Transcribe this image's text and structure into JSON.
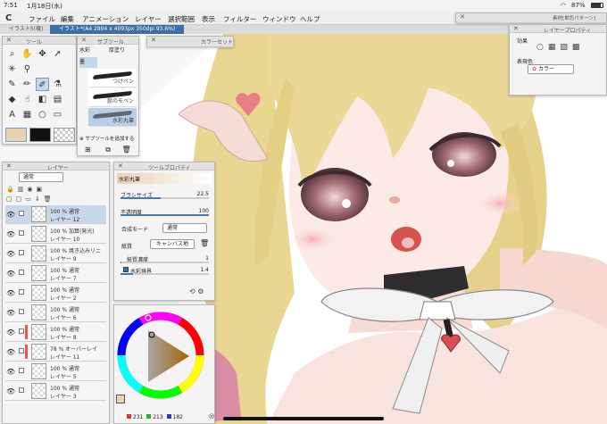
{
  "status": {
    "time": "7:51",
    "date": "1月18日(水)",
    "battery": "87%"
  },
  "menu": {
    "logo": "C",
    "items": [
      "ファイル",
      "編集",
      "アニメーション",
      "レイヤー",
      "選択範囲",
      "表示",
      "フィルター",
      "ウィンドウ",
      "ヘルプ"
    ]
  },
  "tabs": [
    {
      "label": "イラスト5(複)"
    },
    {
      "label": "イラスト*(A4 2894 x 4093px 350dpi 93.6%)"
    }
  ],
  "tool_panel": {
    "title": "ツール"
  },
  "subtool_panel": {
    "title": "サブツール",
    "tabs": [
      "水彩",
      "厚塗り"
    ],
    "group": "墨",
    "brushes": [
      "つけペン",
      "髭のモペン",
      "水彩丸筆"
    ],
    "add_label": "サブツールを追加する"
  },
  "color_set_panel": {
    "title": "カラーセット"
  },
  "layer_panel": {
    "title": "レイヤー",
    "blend_mode": "通常",
    "layers": [
      {
        "mode": "100 % 通常",
        "name": "レイヤー 12",
        "selected": true,
        "bar": "",
        "visible": true
      },
      {
        "mode": "100 % 加算(発光)",
        "name": "レイヤー 10",
        "selected": false,
        "bar": "",
        "visible": true
      },
      {
        "mode": "100 % 焼き込みリニ",
        "name": "レイヤー 9",
        "selected": false,
        "bar": "",
        "visible": true
      },
      {
        "mode": "100 % 通常",
        "name": "レイヤー 7",
        "selected": false,
        "bar": "",
        "visible": true
      },
      {
        "mode": "100 % 通常",
        "name": "レイヤー 2",
        "selected": false,
        "bar": "",
        "visible": true
      },
      {
        "mode": "100 % 通常",
        "name": "レイヤー 6",
        "selected": false,
        "bar": "",
        "visible": true
      },
      {
        "mode": "100 % 通常",
        "name": "レイヤー 8",
        "selected": false,
        "bar": "#e35a5a",
        "visible": true
      },
      {
        "mode": "78 % オーバーレイ",
        "name": "レイヤー 11",
        "selected": false,
        "bar": "#e35a5a",
        "visible": true
      },
      {
        "mode": "100 % 通常",
        "name": "レイヤー 5",
        "selected": false,
        "bar": "",
        "visible": true
      },
      {
        "mode": "100 % 通常",
        "name": "レイヤー 3",
        "selected": false,
        "bar": "",
        "visible": true
      }
    ]
  },
  "tool_property": {
    "title": "ツールプロパティ",
    "brush_name": "水彩丸筆",
    "brush_size": {
      "label": "ブラシサイズ",
      "value": "22.5",
      "fraction": 0.45
    },
    "opacity": {
      "label": "不透明度",
      "value": "100",
      "fraction": 1.0
    },
    "blend": {
      "label": "合成モード",
      "value": "通常"
    },
    "paper": {
      "label": "紙質",
      "value": "キャンバス地"
    },
    "paper_density": {
      "label": "紙質濃度",
      "value": "1",
      "fraction": 0.01
    },
    "watercolor_edge": {
      "label": "水彩境界",
      "value": "1.4",
      "fraction": 0.14
    }
  },
  "color_wheel": {
    "r": "231",
    "g": "213",
    "b": "182"
  },
  "material_panel": {
    "title": "素材[単色パターン]"
  },
  "layer_property": {
    "title": "レイヤープロパティ",
    "effect_label": "効果",
    "display_color_label": "表現色",
    "display_color_value": "カラー"
  },
  "colors": {
    "accent": "#3c6fa6",
    "main_color": "#e8d4b5",
    "sub_color": "#111111"
  }
}
